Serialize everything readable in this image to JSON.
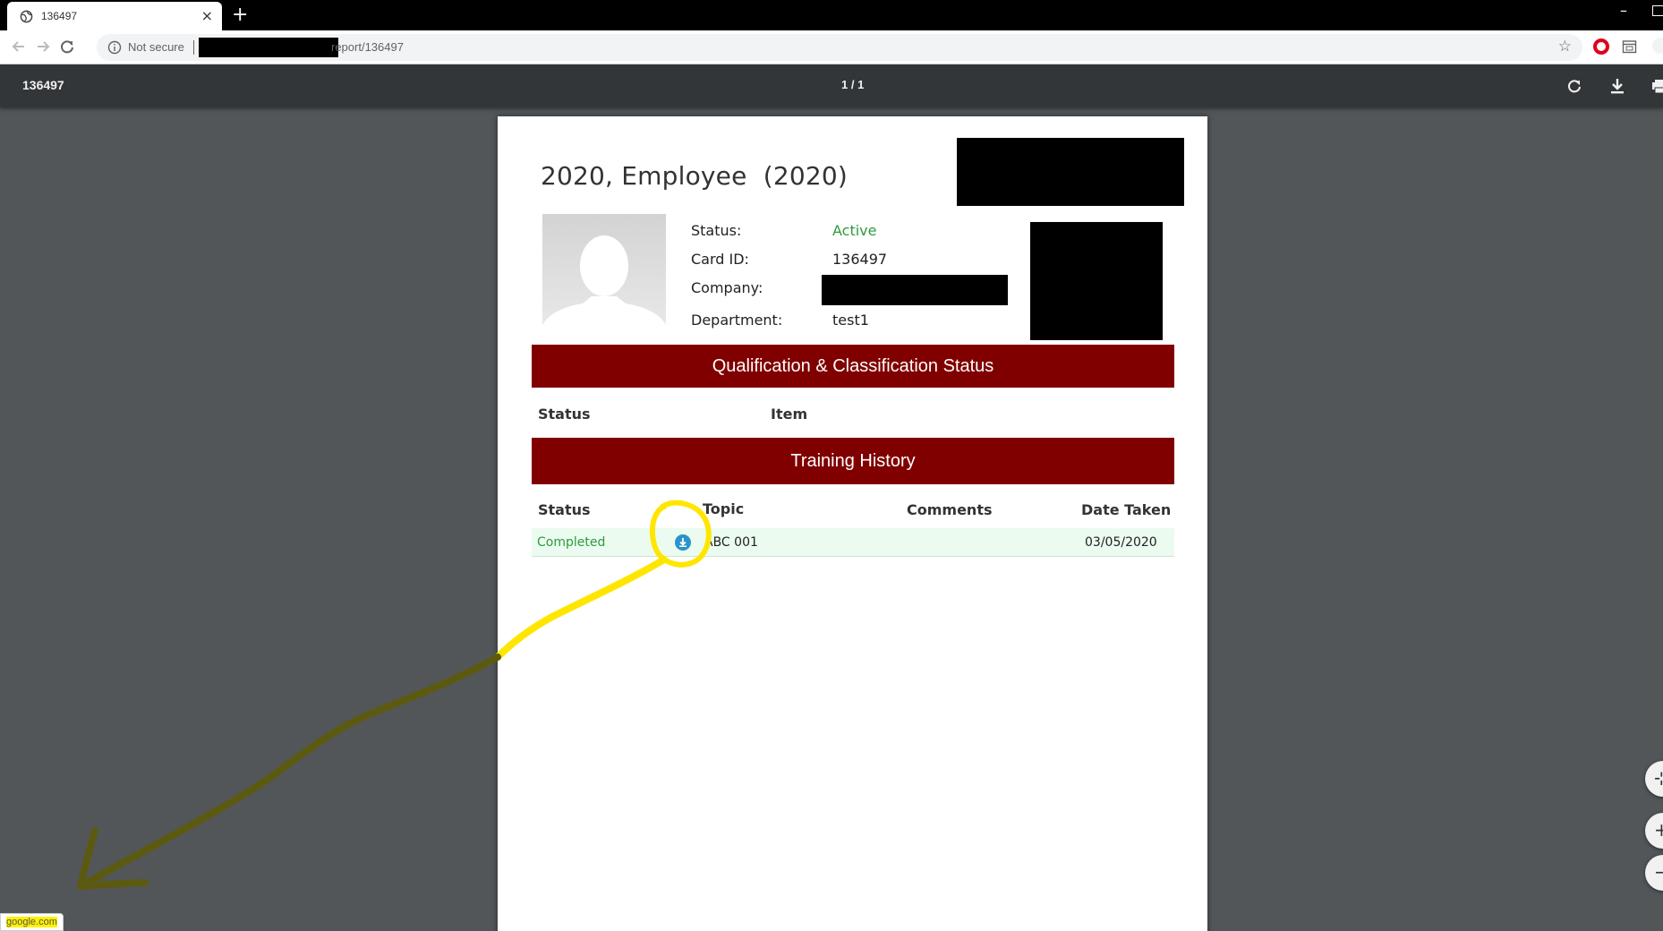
{
  "browser": {
    "tab_title": "136497",
    "tab_close": "×",
    "new_tab": "+",
    "window_minimize": "–",
    "omnibox": {
      "security_text": "Not secure",
      "url_visible": "report/136497",
      "star": "☆"
    }
  },
  "pdf_viewer": {
    "title": "136497",
    "page_indicator": "1 / 1"
  },
  "report": {
    "heading": "2020, Employee  (2020)",
    "info": {
      "status_label": "Status:",
      "status_value": "Active",
      "card_label": "Card ID:",
      "card_value": "136497",
      "company_label": "Company:",
      "company_value": "",
      "department_label": "Department:",
      "department_value": "test1"
    },
    "qualification": {
      "title": "Qualification & Classification Status",
      "columns": [
        "Status",
        "Item"
      ]
    },
    "training": {
      "title": "Training History",
      "columns": [
        "Status",
        "Topic",
        "Comments",
        "Date Taken"
      ],
      "rows": [
        {
          "status": "Completed",
          "topic": "ABC 001",
          "comments": "",
          "date_taken": "03/05/2020"
        }
      ]
    }
  },
  "zoom": {
    "fit_label": "⊹",
    "zoom_in_label": "+",
    "zoom_out_label": "−"
  },
  "status_bubble": "google.com",
  "colors": {
    "section_bar": "#800000",
    "active_green": "#2e9b3a",
    "row_bg": "#ebfbef",
    "annotation_yellow": "#ffe600",
    "annotation_olive": "#5c5a10",
    "download_icon": "#2a93c9"
  }
}
